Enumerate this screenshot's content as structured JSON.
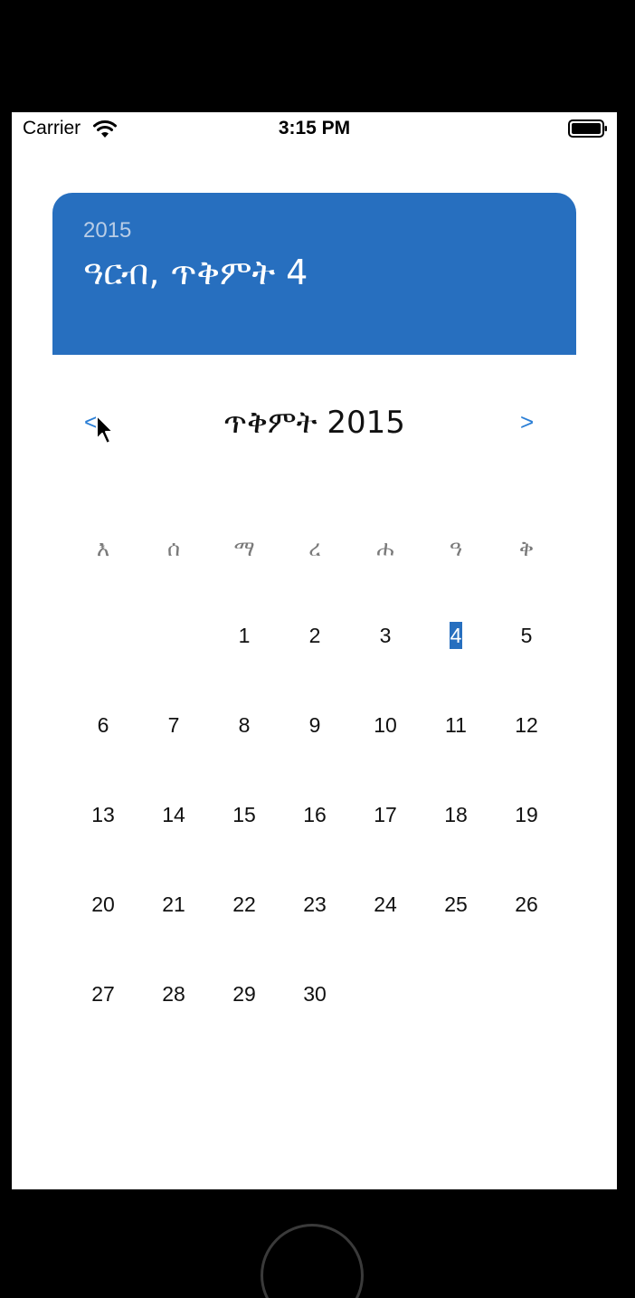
{
  "status_bar": {
    "carrier": "Carrier",
    "time": "3:15 PM",
    "wifi_icon": "wifi-icon",
    "battery_icon": "battery-icon"
  },
  "header": {
    "year": "2015",
    "selected_date": "ዓርብ, ጥቅምት 4",
    "color": "#276fbf"
  },
  "month_nav": {
    "prev_label": "<",
    "next_label": ">",
    "title": "ጥቅምት 2015"
  },
  "weekdays": [
    "እ",
    "ሰ",
    "ማ",
    "ረ",
    "ሐ",
    "ዓ",
    "ቅ"
  ],
  "days": [
    "",
    "",
    "1",
    "2",
    "3",
    "4",
    "5",
    "6",
    "7",
    "8",
    "9",
    "10",
    "11",
    "12",
    "13",
    "14",
    "15",
    "16",
    "17",
    "18",
    "19",
    "20",
    "21",
    "22",
    "23",
    "24",
    "25",
    "26",
    "27",
    "28",
    "29",
    "30",
    "",
    "",
    ""
  ],
  "selected_day": "4",
  "accent_color": "#2b7fd6"
}
